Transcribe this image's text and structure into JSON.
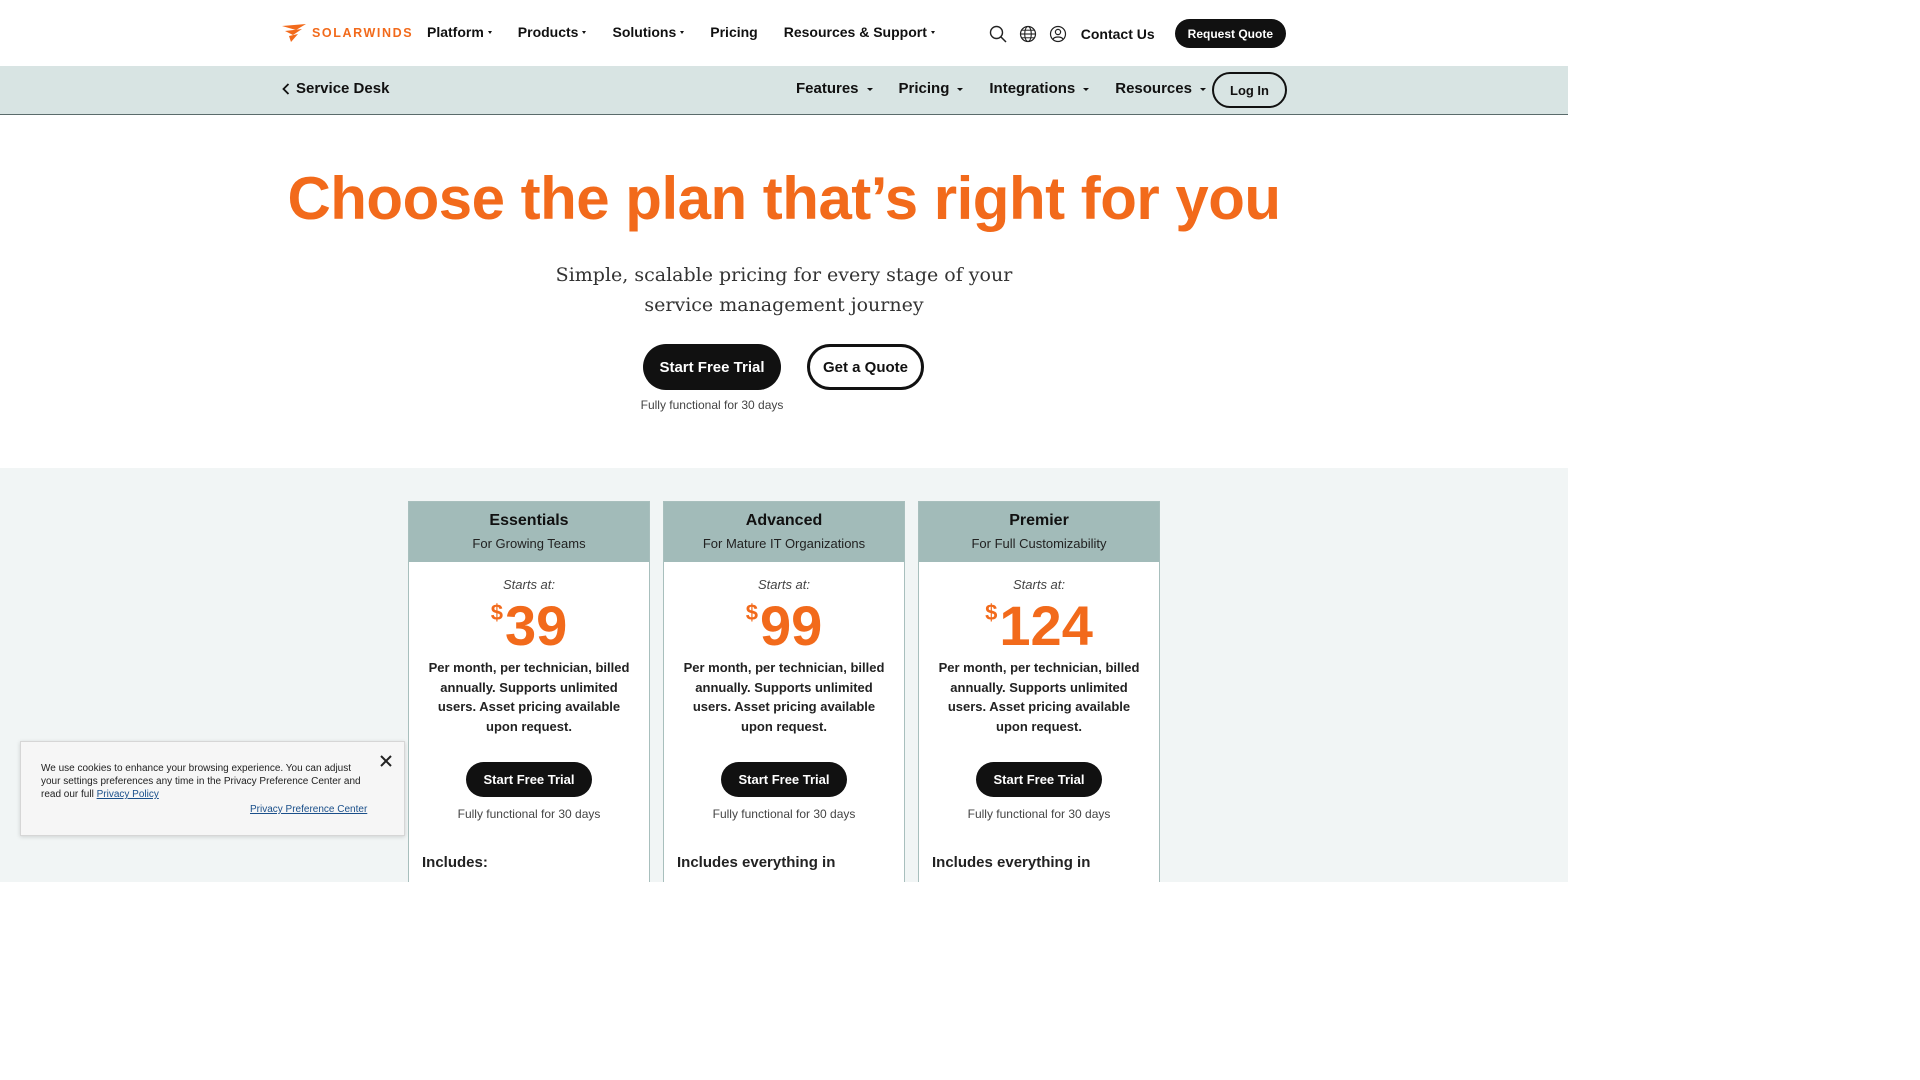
{
  "brand": {
    "name": "SOLARWINDS",
    "color": "#f26a1b"
  },
  "topnav": {
    "menu": [
      "Platform",
      "Products",
      "Solutions",
      "Pricing",
      "Resources & Support"
    ],
    "icons": [
      "search-icon",
      "globe-icon",
      "user-icon"
    ],
    "contact": "Contact Us",
    "request_quote": "Request Quote"
  },
  "subnav": {
    "back_label": "Service Desk",
    "items": [
      "Features",
      "Pricing",
      "Integrations",
      "Resources"
    ],
    "login": "Log In"
  },
  "hero": {
    "title": "Choose the plan that’s right for you",
    "subtitle": "Simple, scalable pricing for every stage of your service management journey",
    "trial_button": "Start Free Trial",
    "quote_button": "Get a Quote",
    "note": "Fully functional for 30 days"
  },
  "plans": [
    {
      "name": "Essentials",
      "tagline": "For Growing Teams",
      "starts": "Starts at:",
      "currency": "$",
      "price": "39",
      "description": "Per month, per technician, billed annually. Supports unlimited users. Asset pricing available upon request.",
      "button": "Start Free Trial",
      "note": "Fully functional for 30 days",
      "includes": "Includes:"
    },
    {
      "name": "Advanced",
      "tagline": "For Mature IT Organizations",
      "starts": "Starts at:",
      "currency": "$",
      "price": "99",
      "description": "Per month, per technician, billed annually. Supports unlimited users. Asset pricing available upon request.",
      "button": "Start Free Trial",
      "note": "Fully functional for 30 days",
      "includes": "Includes everything in"
    },
    {
      "name": "Premier",
      "tagline": "For Full Customizability",
      "starts": "Starts at:",
      "currency": "$",
      "price": "124",
      "description": "Per month, per technician, billed annually. Supports unlimited users. Asset pricing available upon request.",
      "button": "Start Free Trial",
      "note": "Fully functional for 30 days",
      "includes": "Includes everything in"
    }
  ],
  "cookie": {
    "text": "We use cookies to enhance your browsing experience. You can adjust your settings preferences any time in the Privacy Preference Center and read our full",
    "policy_link": "Privacy Policy",
    "preference_link": "Privacy Preference Center"
  }
}
